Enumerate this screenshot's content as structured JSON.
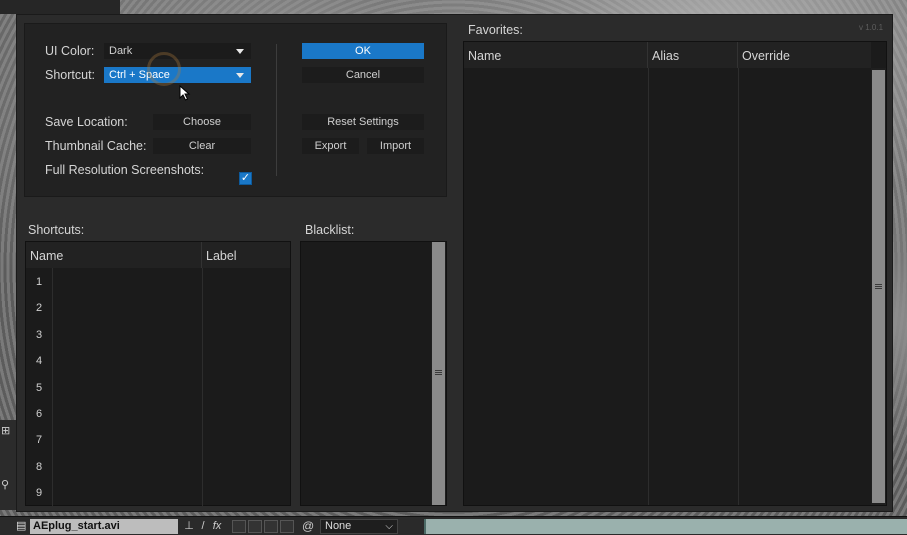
{
  "dialog": {
    "version": "v 1.0.1",
    "settings": {
      "ui_color_label": "UI Color:",
      "ui_color_value": "Dark",
      "shortcut_label": "Shortcut:",
      "shortcut_value": "Ctrl + Space",
      "save_location_label": "Save Location:",
      "choose_label": "Choose",
      "thumbnail_cache_label": "Thumbnail Cache:",
      "clear_label": "Clear",
      "full_res_label": "Full Resolution Screenshots:",
      "full_res_checked": "✓"
    },
    "actions": {
      "ok_label": "OK",
      "cancel_label": "Cancel",
      "reset_label": "Reset Settings",
      "export_label": "Export",
      "import_label": "Import"
    },
    "shortcuts": {
      "title": "Shortcuts:",
      "columns": [
        "Name",
        "Label"
      ],
      "rows": [
        "1",
        "2",
        "3",
        "4",
        "5",
        "6",
        "7",
        "8",
        "9"
      ]
    },
    "blacklist": {
      "title": "Blacklist:"
    },
    "favorites": {
      "title": "Favorites:",
      "columns": [
        "Name",
        "Alias",
        "Override"
      ]
    }
  },
  "host": {
    "file_name": "AEplug_start.avi",
    "select_value": "None"
  },
  "colors": {
    "accent": "#1a78c8",
    "panel": "#222222",
    "table_bg": "#1b1b1b"
  }
}
